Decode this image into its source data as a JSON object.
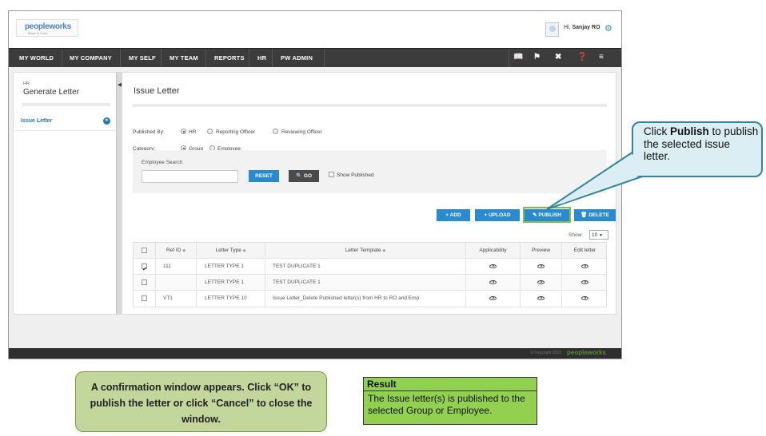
{
  "header": {
    "logo_text": "peopleworks",
    "logo_tagline": "Made in India",
    "greeting": "Hi, ",
    "user_name": "Sanjay RO"
  },
  "nav": {
    "items": [
      "MY WORLD",
      "MY COMPANY",
      "MY SELF",
      "MY TEAM",
      "REPORTS",
      "HR",
      "PW ADMIN"
    ],
    "icons": [
      "book-icon",
      "flag-icon",
      "tools-icon",
      "help-icon",
      "sitemap-icon"
    ]
  },
  "sidebar": {
    "module": "HR",
    "title": "Generate Letter",
    "items": [
      {
        "label": "Issue Letter"
      }
    ]
  },
  "main": {
    "title": "Issue Letter",
    "published_by_label": "Published By:",
    "published_by_options": [
      "HR",
      "Reporting Officer",
      "Reviewing Officer"
    ],
    "published_by_selected": "HR",
    "category_label": "Category:",
    "category_options": [
      "Group",
      "Employee"
    ],
    "category_selected": "Group",
    "employee_search_label": "Employee Search",
    "employee_search_value": "",
    "reset_label": "RESET",
    "go_label": "GO",
    "show_published_label": "Show Published",
    "add_label": "ADD",
    "upload_label": "UPLOAD",
    "publish_label": "PUBLISH",
    "delete_label": "DELETE",
    "show_label": "Show:",
    "show_value": "10"
  },
  "table": {
    "headers": [
      "Ref ID",
      "Letter Type",
      "Letter Template",
      "Applicability",
      "Preview",
      "Edit letter"
    ],
    "rows": [
      {
        "checked": true,
        "ref_id": "111",
        "letter_type": "LETTER TYPE 1",
        "template": "TEST DUPLICATE 1"
      },
      {
        "checked": false,
        "ref_id": "",
        "letter_type": "LETTER TYPE 1",
        "template": "TEST DUPLICATE 1"
      },
      {
        "checked": false,
        "ref_id": "VT1",
        "letter_type": "LETTER TYPE 10",
        "template": "Issue Letter_Delete Published letter(s) from HR to RO and Emp"
      }
    ]
  },
  "footer": {
    "copyright": "© Copyright 2015",
    "brand": "peopleworks"
  },
  "callout": {
    "text_pre": "Click ",
    "text_bold": "Publish",
    "text_post": " to publish the selected issue letter."
  },
  "note": {
    "text": "A confirmation window appears. Click “OK” to publish the letter or click “Cancel” to close the window."
  },
  "result": {
    "title": "Result",
    "text": "The Issue letter(s) is published to the selected Group or Employee."
  },
  "colors": {
    "nav_bg": "#3c3c3c",
    "accent_blue": "#2a8ad0",
    "highlight_green": "#7ac143",
    "callout_bg": "#daeef3",
    "note_bg": "#c3d69b",
    "result_bg": "#92d050"
  }
}
